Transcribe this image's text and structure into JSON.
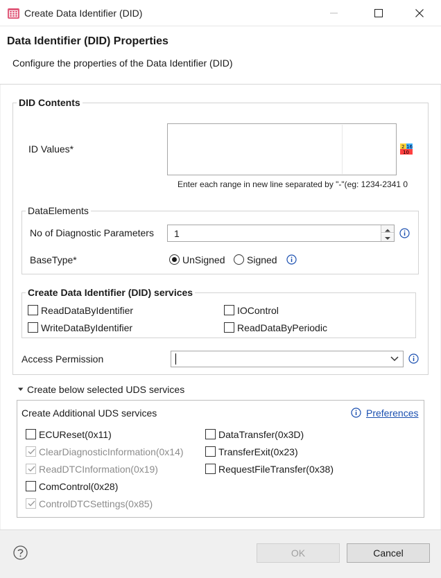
{
  "window": {
    "title": "Create Data Identifier (DID)",
    "icons": {
      "app": "calendar-grid-icon",
      "minimize": "minimize-icon",
      "maximize": "maximize-icon",
      "close": "close-icon"
    }
  },
  "header": {
    "title": "Data Identifier (DID) Properties",
    "subtitle": "Configure the properties of the Data Identifier (DID)"
  },
  "did_contents": {
    "legend": "DID Contents",
    "id_values_label": "ID Values*",
    "id_values_value": "",
    "hex_dec_icon_text": {
      "top1": "2",
      "top2": "16",
      "bottom": "10"
    },
    "hint": "Enter each range in new line separated by \"-\"(eg: 1234-2341 0"
  },
  "data_elements": {
    "legend": "DataElements",
    "num_params_label": "No of Diagnostic Parameters",
    "num_params_value": "1",
    "base_type_label": "BaseType*",
    "base_type_options": [
      "UnSigned",
      "Signed"
    ],
    "base_type_selected": "UnSigned"
  },
  "did_services": {
    "legend": "Create Data Identifier (DID) services",
    "items": [
      {
        "label": "ReadDataByIdentifier",
        "checked": false
      },
      {
        "label": "IOControl",
        "checked": false
      },
      {
        "label": "WriteDataByIdentifier",
        "checked": false
      },
      {
        "label": "ReadDataByPeriodic",
        "checked": false
      }
    ]
  },
  "access_permission": {
    "label": "Access Permission",
    "value": ""
  },
  "uds_section": {
    "expander_label": "Create below selected UDS services",
    "panel_title": "Create Additional UDS services",
    "preferences_link": "Preferences",
    "left_items": [
      {
        "label": "ECUReset(0x11)",
        "checked": false,
        "disabled": false
      },
      {
        "label": "ClearDiagnosticInformation(0x14)",
        "checked": true,
        "disabled": true
      },
      {
        "label": "ReadDTCInformation(0x19)",
        "checked": true,
        "disabled": true
      },
      {
        "label": "ComControl(0x28)",
        "checked": false,
        "disabled": false
      },
      {
        "label": "ControlDTCSettings(0x85)",
        "checked": true,
        "disabled": true
      }
    ],
    "right_items": [
      {
        "label": "DataTransfer(0x3D)",
        "checked": false,
        "disabled": false
      },
      {
        "label": "TransferExit(0x23)",
        "checked": false,
        "disabled": false
      },
      {
        "label": "RequestFileTransfer(0x38)",
        "checked": false,
        "disabled": false
      }
    ]
  },
  "footer": {
    "ok_label": "OK",
    "cancel_label": "Cancel",
    "ok_enabled": false
  },
  "colors": {
    "link": "#1a4fb0",
    "info_icon": "#1a4fb0",
    "disabled_text": "#8c8c8c"
  }
}
